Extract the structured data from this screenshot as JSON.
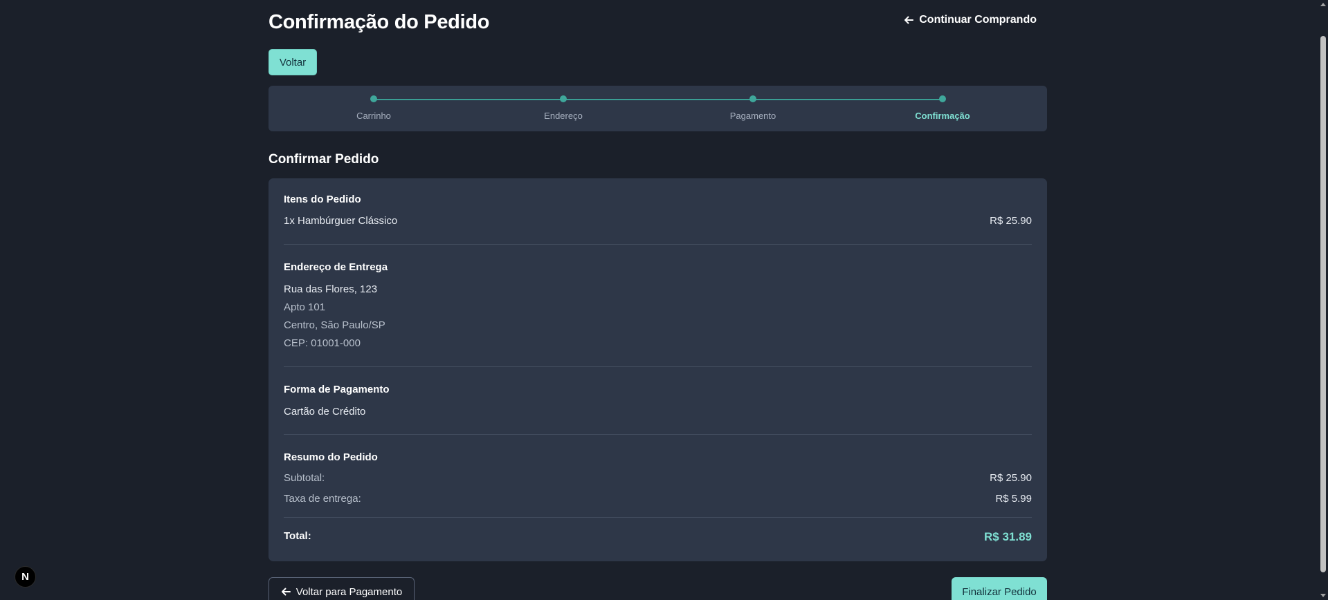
{
  "header": {
    "title": "Confirmação do Pedido",
    "continue_label": "Continuar Comprando"
  },
  "back_button_label": "Voltar",
  "stepper": {
    "steps": [
      {
        "label": "Carrinho",
        "active": false
      },
      {
        "label": "Endereço",
        "active": false
      },
      {
        "label": "Pagamento",
        "active": false
      },
      {
        "label": "Confirmação",
        "active": true
      }
    ]
  },
  "section_title": "Confirmar Pedido",
  "items": {
    "title": "Itens do Pedido",
    "list": [
      {
        "name": "1x Hambúrguer Clássico",
        "price": "R$ 25.90"
      }
    ]
  },
  "address": {
    "title": "Endereço de Entrega",
    "street": "Rua das Flores, 123",
    "complement": "Apto 101",
    "city": "Centro, São Paulo/SP",
    "cep": "CEP: 01001-000"
  },
  "payment": {
    "title": "Forma de Pagamento",
    "method": "Cartão de Crédito"
  },
  "summary": {
    "title": "Resumo do Pedido",
    "subtotal_label": "Subtotal:",
    "subtotal_value": "R$ 25.90",
    "delivery_label": "Taxa de entrega:",
    "delivery_value": "R$ 5.99",
    "total_label": "Total:",
    "total_value": "R$ 31.89"
  },
  "footer": {
    "back_to_payment_label": "Voltar para Pagamento",
    "finish_label": "Finalizar Pedido"
  },
  "badge": {
    "letter": "N"
  },
  "colors": {
    "background": "#1b202a",
    "card": "#2e3748",
    "accent": "#7fe0d3",
    "progress": "#3a9f95"
  }
}
